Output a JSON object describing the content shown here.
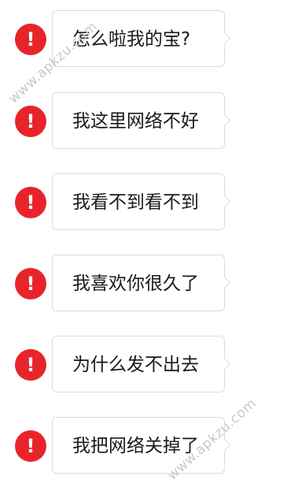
{
  "messages": [
    {
      "text": "怎么啦我的宝?",
      "status_icon": "exclamation-icon",
      "status_symbol": "!"
    },
    {
      "text": "我这里网络不好",
      "status_icon": "exclamation-icon",
      "status_symbol": "!"
    },
    {
      "text": "我看不到看不到",
      "status_icon": "exclamation-icon",
      "status_symbol": "!"
    },
    {
      "text": "我喜欢你很久了",
      "status_icon": "exclamation-icon",
      "status_symbol": "!"
    },
    {
      "text": "为什么发不出去",
      "status_icon": "exclamation-icon",
      "status_symbol": "!"
    },
    {
      "text": "我把网络关掉了",
      "status_icon": "exclamation-icon",
      "status_symbol": "!"
    }
  ],
  "watermarks": [
    {
      "text": "www.apkzu.com"
    },
    {
      "text": "www.apkzu.com"
    }
  ],
  "colors": {
    "error_red": "#e8242b",
    "bubble_border": "#dcdcdc",
    "text": "#1a1a1a",
    "watermark": "#c8c8c8"
  }
}
